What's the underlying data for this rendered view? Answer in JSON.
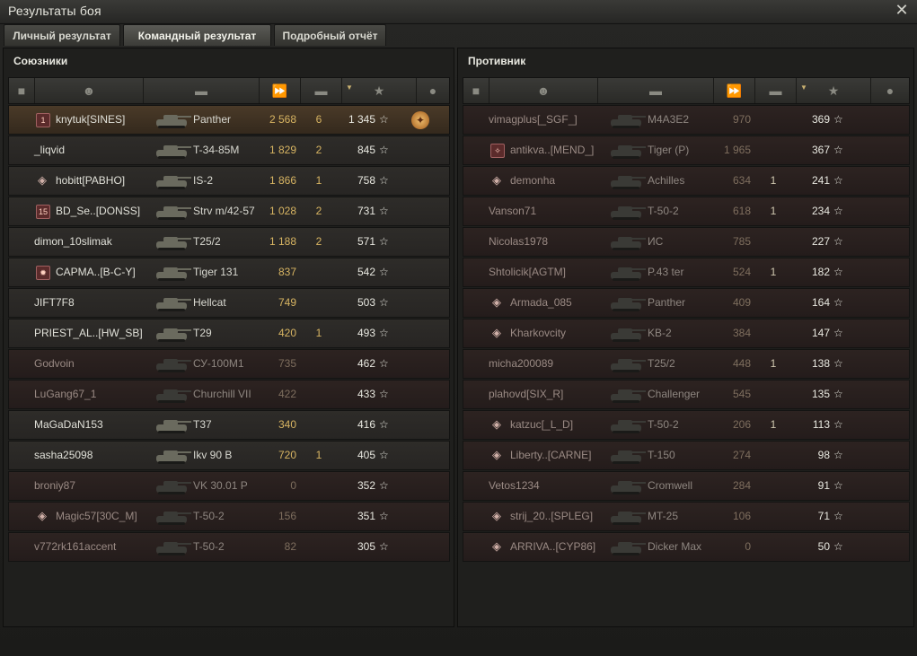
{
  "window": {
    "title": "Результаты боя",
    "close": "✕"
  },
  "tabs": [
    {
      "label": "Личный результат",
      "active": false
    },
    {
      "label": "Командный результат",
      "active": true
    },
    {
      "label": "Подробный отчёт",
      "active": false
    }
  ],
  "header_icons": [
    "platoon-icon",
    "player-icon",
    "tank-icon",
    "damage-icon",
    "frags-icon",
    "xp-star-icon",
    "medal-icon"
  ],
  "colors": {
    "damage": "#d7b462",
    "dead_row": "#2d2321",
    "me_row": "#4a3a28"
  },
  "allies": {
    "title": "Союзники",
    "rows": [
      {
        "name": "knytuk[SINES]",
        "vehicle": "Panther",
        "damage": "2 568",
        "frags": "6",
        "xp": "1 345",
        "star": "☆",
        "badge": "clan",
        "badge_text": "1",
        "me": true,
        "dead": false,
        "medal": "✦"
      },
      {
        "name": "_liqvid",
        "vehicle": "T-34-85M",
        "damage": "1 829",
        "frags": "2",
        "xp": "845",
        "star": "☆",
        "badge": "",
        "badge_text": "",
        "me": false,
        "dead": false,
        "medal": ""
      },
      {
        "name": "hobitt[PABHO]",
        "vehicle": "IS-2",
        "damage": "1 866",
        "frags": "1",
        "xp": "758",
        "star": "☆",
        "badge": "rank",
        "badge_text": "◈",
        "me": false,
        "dead": false,
        "medal": ""
      },
      {
        "name": "BD_Se..[DONSS]",
        "vehicle": "Strv m/42-57",
        "damage": "1 028",
        "frags": "2",
        "xp": "731",
        "star": "☆",
        "badge": "clan",
        "badge_text": "15",
        "me": false,
        "dead": false,
        "medal": ""
      },
      {
        "name": "dimon_10slimak",
        "vehicle": "T25/2",
        "damage": "1 188",
        "frags": "2",
        "xp": "571",
        "star": "☆",
        "badge": "",
        "badge_text": "",
        "me": false,
        "dead": false,
        "medal": ""
      },
      {
        "name": "CAPMA..[B-C-Y]",
        "vehicle": "Tiger 131",
        "damage": "837",
        "frags": "",
        "xp": "542",
        "star": "☆",
        "badge": "clan",
        "badge_text": "✹",
        "me": false,
        "dead": false,
        "medal": ""
      },
      {
        "name": "JIFT7F8",
        "vehicle": "Hellcat",
        "damage": "749",
        "frags": "",
        "xp": "503",
        "star": "☆",
        "badge": "",
        "badge_text": "",
        "me": false,
        "dead": false,
        "medal": ""
      },
      {
        "name": "PRIEST_AL..[HW_SB]",
        "vehicle": "T29",
        "damage": "420",
        "frags": "1",
        "xp": "493",
        "star": "☆",
        "badge": "",
        "badge_text": "",
        "me": false,
        "dead": false,
        "medal": ""
      },
      {
        "name": "Godvoin",
        "vehicle": "СУ-100М1",
        "damage": "735",
        "frags": "",
        "xp": "462",
        "star": "☆",
        "badge": "",
        "badge_text": "",
        "me": false,
        "dead": true,
        "medal": ""
      },
      {
        "name": "LuGang67_1",
        "vehicle": "Churchill VII",
        "damage": "422",
        "frags": "",
        "xp": "433",
        "star": "☆",
        "badge": "",
        "badge_text": "",
        "me": false,
        "dead": true,
        "medal": ""
      },
      {
        "name": "MaGaDaN153",
        "vehicle": "T37",
        "damage": "340",
        "frags": "",
        "xp": "416",
        "star": "☆",
        "badge": "",
        "badge_text": "",
        "me": false,
        "dead": false,
        "medal": ""
      },
      {
        "name": "sasha25098",
        "vehicle": "Ikv 90 B",
        "damage": "720",
        "frags": "1",
        "xp": "405",
        "star": "☆",
        "badge": "",
        "badge_text": "",
        "me": false,
        "dead": false,
        "medal": ""
      },
      {
        "name": "broniy87",
        "vehicle": "VK 30.01 P",
        "damage": "0",
        "frags": "",
        "xp": "352",
        "star": "☆",
        "badge": "",
        "badge_text": "",
        "me": false,
        "dead": true,
        "medal": ""
      },
      {
        "name": "Magic57[30C_M]",
        "vehicle": "T-50-2",
        "damage": "156",
        "frags": "",
        "xp": "351",
        "star": "☆",
        "badge": "rank",
        "badge_text": "◈",
        "me": false,
        "dead": true,
        "medal": ""
      },
      {
        "name": "v772rk161accent",
        "vehicle": "T-50-2",
        "damage": "82",
        "frags": "",
        "xp": "305",
        "star": "☆",
        "badge": "",
        "badge_text": "",
        "me": false,
        "dead": true,
        "medal": ""
      }
    ]
  },
  "enemies": {
    "title": "Противник",
    "rows": [
      {
        "name": "vimagplus[_SGF_]",
        "vehicle": "M4A3E2",
        "damage": "970",
        "frags": "",
        "xp": "369",
        "star": "☆",
        "badge": "",
        "badge_text": "",
        "dead": true
      },
      {
        "name": "antikva..[MEND_]",
        "vehicle": "Tiger (P)",
        "damage": "1 965",
        "frags": "",
        "xp": "367",
        "star": "☆",
        "badge": "clan",
        "badge_text": "✧",
        "dead": true
      },
      {
        "name": "demonha",
        "vehicle": "Achilles",
        "damage": "634",
        "frags": "1",
        "xp": "241",
        "star": "☆",
        "badge": "rank",
        "badge_text": "◈",
        "dead": true
      },
      {
        "name": "Vanson71",
        "vehicle": "T-50-2",
        "damage": "618",
        "frags": "1",
        "xp": "234",
        "star": "☆",
        "badge": "",
        "badge_text": "",
        "dead": true
      },
      {
        "name": "Nicolas1978",
        "vehicle": "ИС",
        "damage": "785",
        "frags": "",
        "xp": "227",
        "star": "☆",
        "badge": "",
        "badge_text": "",
        "dead": true
      },
      {
        "name": "Shtolicik[AGTM]",
        "vehicle": "P.43 ter",
        "damage": "524",
        "frags": "1",
        "xp": "182",
        "star": "☆",
        "badge": "",
        "badge_text": "",
        "dead": true
      },
      {
        "name": "Armada_085",
        "vehicle": "Panther",
        "damage": "409",
        "frags": "",
        "xp": "164",
        "star": "☆",
        "badge": "rank",
        "badge_text": "◈",
        "dead": true
      },
      {
        "name": "Kharkovcity",
        "vehicle": "KB-2",
        "damage": "384",
        "frags": "",
        "xp": "147",
        "star": "☆",
        "badge": "rank",
        "badge_text": "◈",
        "dead": true
      },
      {
        "name": "micha200089",
        "vehicle": "T25/2",
        "damage": "448",
        "frags": "1",
        "xp": "138",
        "star": "☆",
        "badge": "",
        "badge_text": "",
        "dead": true
      },
      {
        "name": "plahovd[SIX_R]",
        "vehicle": "Challenger",
        "damage": "545",
        "frags": "",
        "xp": "135",
        "star": "☆",
        "badge": "",
        "badge_text": "",
        "dead": true
      },
      {
        "name": "katzuc[_L_D]",
        "vehicle": "T-50-2",
        "damage": "206",
        "frags": "1",
        "xp": "113",
        "star": "☆",
        "badge": "rank",
        "badge_text": "◈",
        "dead": true
      },
      {
        "name": "Liberty..[CARNE]",
        "vehicle": "T-150",
        "damage": "274",
        "frags": "",
        "xp": "98",
        "star": "☆",
        "badge": "rank",
        "badge_text": "◈",
        "dead": true
      },
      {
        "name": "Vetos1234",
        "vehicle": "Cromwell",
        "damage": "284",
        "frags": "",
        "xp": "91",
        "star": "☆",
        "badge": "",
        "badge_text": "",
        "dead": true
      },
      {
        "name": "strij_20..[SPLEG]",
        "vehicle": "MT-25",
        "damage": "106",
        "frags": "",
        "xp": "71",
        "star": "☆",
        "badge": "rank",
        "badge_text": "◈",
        "dead": true
      },
      {
        "name": "ARRIVA..[CYP86]",
        "vehicle": "Dicker Max",
        "damage": "0",
        "frags": "",
        "xp": "50",
        "star": "☆",
        "badge": "rank",
        "badge_text": "◈",
        "dead": true
      }
    ]
  }
}
